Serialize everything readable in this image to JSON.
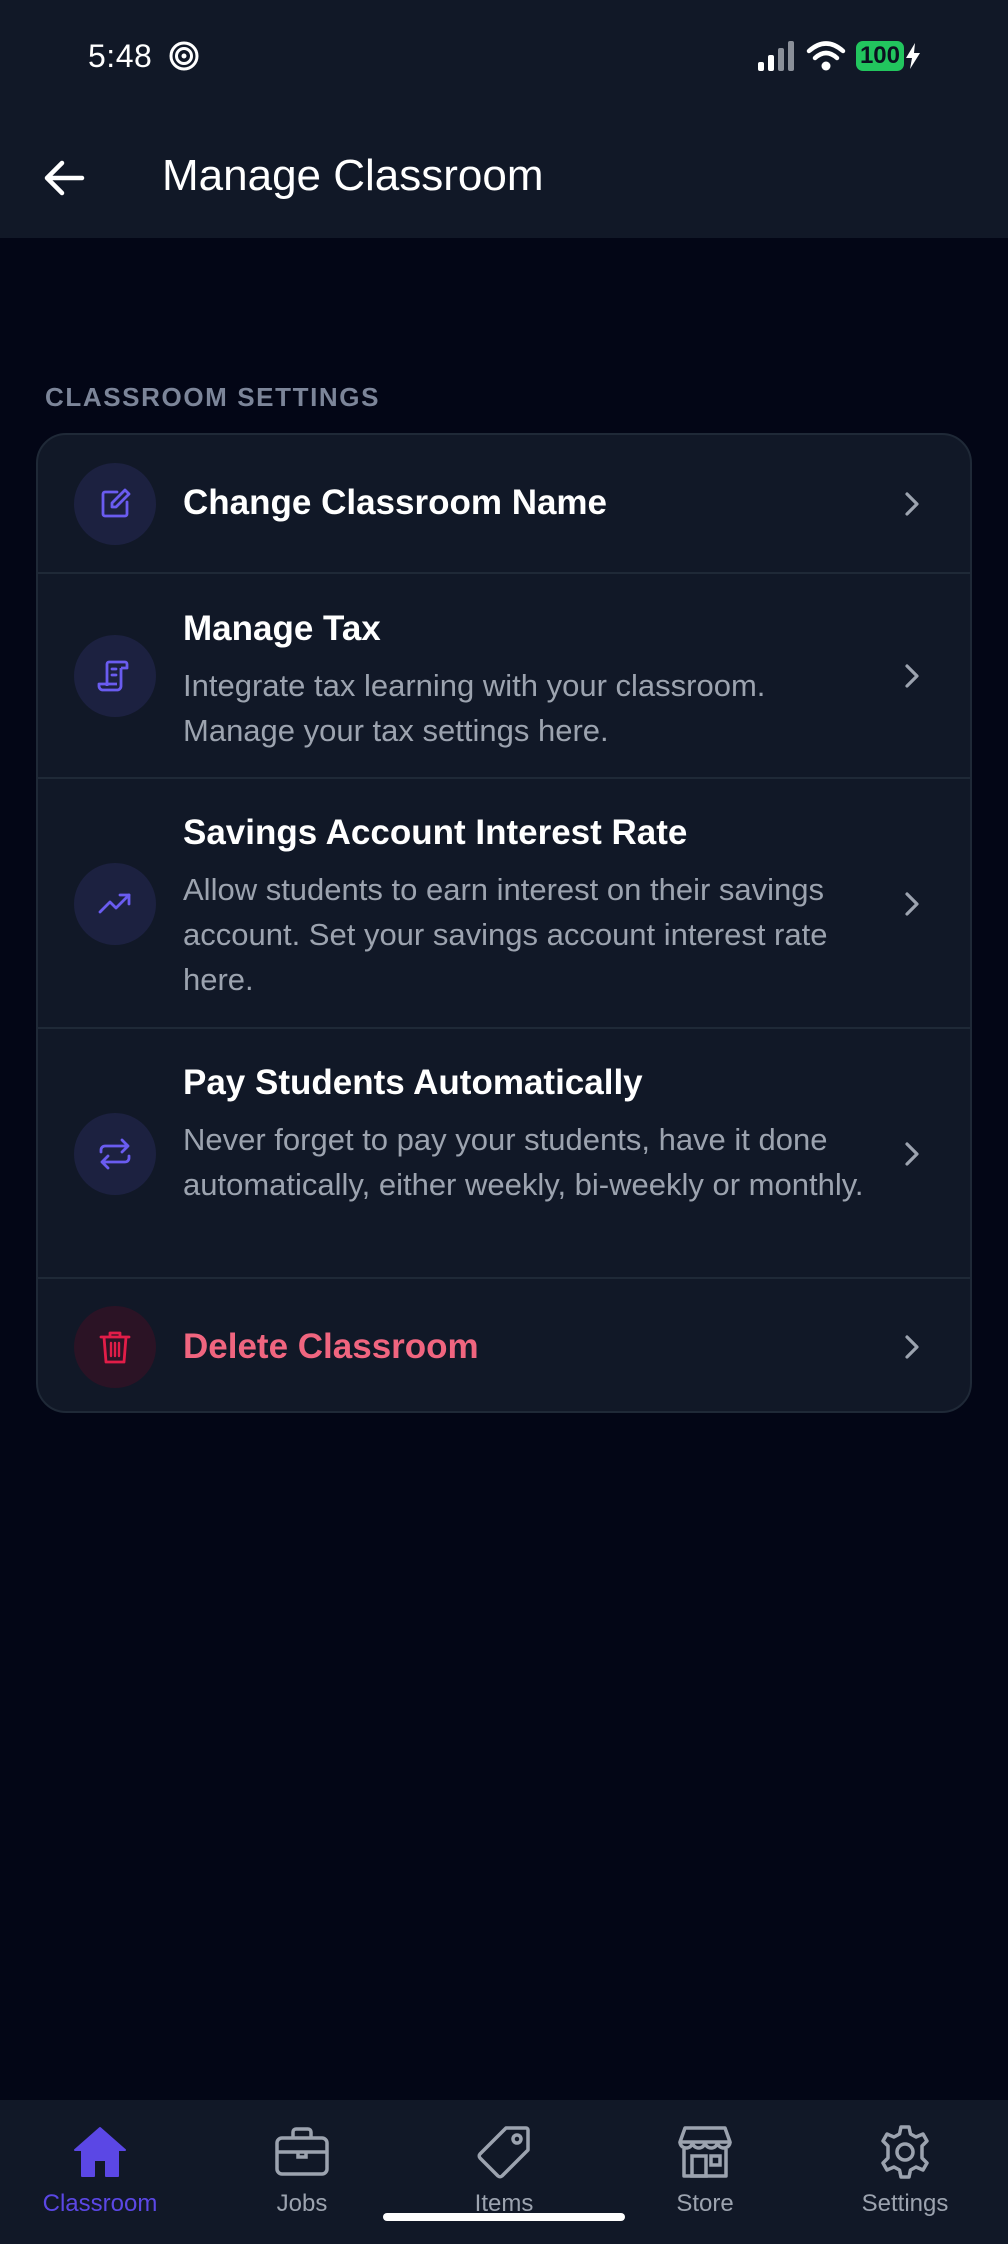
{
  "status_bar": {
    "time": "5:48",
    "battery": "100"
  },
  "header": {
    "title": "Manage Classroom",
    "back_icon": "arrow-left-icon"
  },
  "section": {
    "label": "CLASSROOM SETTINGS"
  },
  "settings": [
    {
      "title": "Change Classroom Name",
      "description": "",
      "icon": "edit-icon"
    },
    {
      "title": "Manage Tax",
      "description": "Integrate tax learning with your classroom. Manage your tax settings here.",
      "icon": "receipt-icon"
    },
    {
      "title": "Savings Account Interest Rate",
      "description": "Allow students to earn interest on their savings account. Set your savings account interest rate here.",
      "icon": "trending-up-icon"
    },
    {
      "title": "Pay Students Automatically",
      "description": "Never forget to pay your students, have it done automatically, either weekly, bi-weekly or monthly.",
      "icon": "repeat-icon"
    },
    {
      "title": "Delete Classroom",
      "description": "",
      "icon": "trash-icon"
    }
  ],
  "nav": [
    {
      "label": "Classroom",
      "icon": "home-icon",
      "active": true
    },
    {
      "label": "Jobs",
      "icon": "briefcase-icon",
      "active": false
    },
    {
      "label": "Items",
      "icon": "tag-icon",
      "active": false
    },
    {
      "label": "Store",
      "icon": "store-icon",
      "active": false
    },
    {
      "label": "Settings",
      "icon": "gear-icon",
      "active": false
    }
  ],
  "colors": {
    "background": "#030616",
    "surface": "#111827",
    "accent": "#5b47e5",
    "danger": "#f0657f",
    "battery": "#22c55e"
  }
}
